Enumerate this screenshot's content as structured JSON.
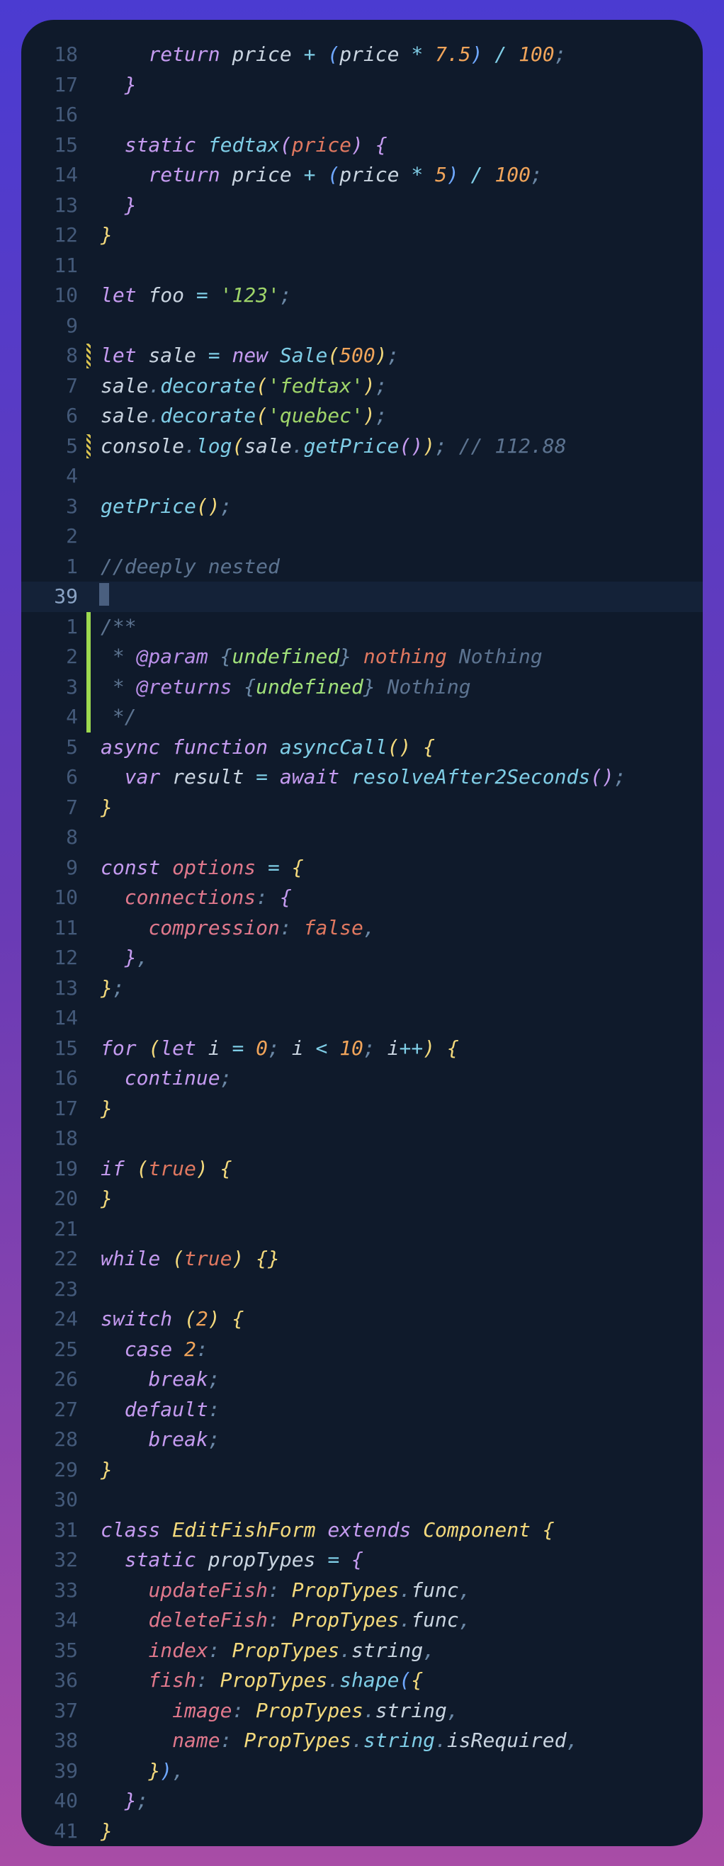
{
  "editor": {
    "theme": "dark",
    "lines": [
      {
        "ln": "18",
        "mark": null,
        "current": false,
        "html": "    <span class='t-kw'>return</span><span class='t-default'> price </span><span class='t-op'>+</span><span class='t-default'> </span><span class='t-brace-b'>(</span><span class='t-default'>price </span><span class='t-op'>*</span><span class='t-default'> </span><span class='t-num'>7.5</span><span class='t-brace-b'>)</span><span class='t-default'> </span><span class='t-op'>/</span><span class='t-default'> </span><span class='t-num'>100</span><span class='t-punc'>;</span>"
      },
      {
        "ln": "17",
        "mark": null,
        "current": false,
        "html": "  <span class='t-brace-p'>}</span>"
      },
      {
        "ln": "16",
        "mark": null,
        "current": false,
        "html": ""
      },
      {
        "ln": "15",
        "mark": null,
        "current": false,
        "html": "  <span class='t-kw'>static</span><span class='t-default'> </span><span class='t-fn t-fnst'>fedtax</span><span class='t-brace-p'>(</span><span class='t-param'>price</span><span class='t-brace-p'>)</span><span class='t-default'> </span><span class='t-brace-p'>{</span>"
      },
      {
        "ln": "14",
        "mark": null,
        "current": false,
        "html": "    <span class='t-kw'>return</span><span class='t-default'> price </span><span class='t-op'>+</span><span class='t-default'> </span><span class='t-brace-b'>(</span><span class='t-default'>price </span><span class='t-op'>*</span><span class='t-default'> </span><span class='t-num'>5</span><span class='t-brace-b'>)</span><span class='t-default'> </span><span class='t-op'>/</span><span class='t-default'> </span><span class='t-num'>100</span><span class='t-punc'>;</span>"
      },
      {
        "ln": "13",
        "mark": null,
        "current": false,
        "html": "  <span class='t-brace-p'>}</span>"
      },
      {
        "ln": "12",
        "mark": null,
        "current": false,
        "html": "<span class='t-brace-y'>}</span>"
      },
      {
        "ln": "11",
        "mark": null,
        "current": false,
        "html": ""
      },
      {
        "ln": "10",
        "mark": null,
        "current": false,
        "html": "<span class='t-kw'>let</span><span class='t-default'> foo </span><span class='t-op'>=</span><span class='t-default'> </span><span class='t-str'>'123'</span><span class='t-punc'>;</span>"
      },
      {
        "ln": "9",
        "mark": null,
        "current": false,
        "html": ""
      },
      {
        "ln": "8",
        "mark": "yellow",
        "current": false,
        "html": "<span class='t-kw'>let</span><span class='t-default'> sale </span><span class='t-op'>=</span><span class='t-default'> </span><span class='t-kw'>new</span><span class='t-default'> </span><span class='t-fn t-fnst'>Sale</span><span class='t-brace-y'>(</span><span class='t-num'>500</span><span class='t-brace-y'>)</span><span class='t-punc'>;</span>"
      },
      {
        "ln": "7",
        "mark": null,
        "current": false,
        "html": "<span class='t-default'>sale</span><span class='t-punc'>.</span><span class='t-fn t-fnst'>decorate</span><span class='t-brace-y'>(</span><span class='t-str'>'fedtax'</span><span class='t-brace-y'>)</span><span class='t-punc'>;</span>"
      },
      {
        "ln": "6",
        "mark": null,
        "current": false,
        "html": "<span class='t-default'>sale</span><span class='t-punc'>.</span><span class='t-fn t-fnst'>decorate</span><span class='t-brace-y'>(</span><span class='t-str'>'quebec'</span><span class='t-brace-y'>)</span><span class='t-punc'>;</span>"
      },
      {
        "ln": "5",
        "mark": "yellow",
        "current": false,
        "html": "<span class='t-default'>console</span><span class='t-punc'>.</span><span class='t-fn t-fnst'>log</span><span class='t-brace-y'>(</span><span class='t-default'>sale</span><span class='t-punc'>.</span><span class='t-fn t-fnst'>getPrice</span><span class='t-brace-p'>(</span><span class='t-brace-p'>)</span><span class='t-brace-y'>)</span><span class='t-punc'>;</span><span class='t-cmt'> // 112.88</span>"
      },
      {
        "ln": "4",
        "mark": null,
        "current": false,
        "html": ""
      },
      {
        "ln": "3",
        "mark": null,
        "current": false,
        "html": "<span class='t-fn t-fnst'>getPrice</span><span class='t-brace-y'>(</span><span class='t-brace-y'>)</span><span class='t-punc'>;</span>"
      },
      {
        "ln": "2",
        "mark": null,
        "current": false,
        "html": ""
      },
      {
        "ln": "1",
        "mark": null,
        "current": false,
        "html": "<span class='t-cmt'>//deeply nested</span>"
      },
      {
        "ln": "39",
        "mark": null,
        "current": true,
        "html": "<span class='cursor-block'></span>"
      },
      {
        "ln": "1",
        "mark": "green",
        "current": false,
        "html": "<span class='t-cmt'>/**</span>"
      },
      {
        "ln": "2",
        "mark": "green",
        "current": false,
        "html": "<span class='t-cmt'> * </span><span class='t-doc-kw'>@param</span><span class='t-cmt'> </span><span class='t-punc'>{</span><span class='t-doc-ty'>undefined</span><span class='t-punc'>}</span><span class='t-cmt'> </span><span class='t-param'>nothing</span><span class='t-cmt'> Nothing</span>"
      },
      {
        "ln": "3",
        "mark": "green",
        "current": false,
        "html": "<span class='t-cmt'> * </span><span class='t-doc-kw'>@returns</span><span class='t-cmt'> </span><span class='t-punc'>{</span><span class='t-doc-ty'>undefined</span><span class='t-punc'>}</span><span class='t-cmt'> Nothing</span>"
      },
      {
        "ln": "4",
        "mark": "green",
        "current": false,
        "html": "<span class='t-cmt'> */</span>"
      },
      {
        "ln": "5",
        "mark": null,
        "current": false,
        "html": "<span class='t-kw'>async</span><span class='t-default'> </span><span class='t-kw'>function</span><span class='t-default'> </span><span class='t-fn t-fnst'>asyncCall</span><span class='t-brace-y'>(</span><span class='t-brace-y'>)</span><span class='t-default'> </span><span class='t-brace-y'>{</span>"
      },
      {
        "ln": "6",
        "mark": null,
        "current": false,
        "html": "  <span class='t-kw'>var</span><span class='t-default'> result </span><span class='t-op'>=</span><span class='t-default'> </span><span class='t-kw'>await</span><span class='t-default'> </span><span class='t-fn t-fnst'>resolveAfter2Seconds</span><span class='t-brace-p'>(</span><span class='t-brace-p'>)</span><span class='t-punc'>;</span>"
      },
      {
        "ln": "7",
        "mark": null,
        "current": false,
        "html": "<span class='t-brace-y'>}</span>"
      },
      {
        "ln": "8",
        "mark": null,
        "current": false,
        "html": ""
      },
      {
        "ln": "9",
        "mark": null,
        "current": false,
        "html": "<span class='t-kw'>const</span><span class='t-default'> </span><span class='t-prop'>options</span><span class='t-default'> </span><span class='t-op'>=</span><span class='t-default'> </span><span class='t-brace-y'>{</span>"
      },
      {
        "ln": "10",
        "mark": null,
        "current": false,
        "html": "  <span class='t-prop'>connections</span><span class='t-punc'>:</span><span class='t-default'> </span><span class='t-brace-p'>{</span>"
      },
      {
        "ln": "11",
        "mark": null,
        "current": false,
        "html": "    <span class='t-prop'>compression</span><span class='t-punc'>:</span><span class='t-default'> </span><span class='t-bool'>false</span><span class='t-punc'>,</span>"
      },
      {
        "ln": "12",
        "mark": null,
        "current": false,
        "html": "  <span class='t-brace-p'>}</span><span class='t-punc'>,</span>"
      },
      {
        "ln": "13",
        "mark": null,
        "current": false,
        "html": "<span class='t-brace-y'>}</span><span class='t-punc'>;</span>"
      },
      {
        "ln": "14",
        "mark": null,
        "current": false,
        "html": ""
      },
      {
        "ln": "15",
        "mark": null,
        "current": false,
        "html": "<span class='t-kw'>for</span><span class='t-default'> </span><span class='t-brace-y'>(</span><span class='t-kw'>let</span><span class='t-default'> i </span><span class='t-op'>=</span><span class='t-default'> </span><span class='t-num'>0</span><span class='t-punc'>;</span><span class='t-default'> i </span><span class='t-op'>&lt;</span><span class='t-default'> </span><span class='t-num'>10</span><span class='t-punc'>;</span><span class='t-default'> i</span><span class='t-op'>++</span><span class='t-brace-y'>)</span><span class='t-default'> </span><span class='t-brace-y'>{</span>"
      },
      {
        "ln": "16",
        "mark": null,
        "current": false,
        "html": "  <span class='t-kw'>continue</span><span class='t-punc'>;</span>"
      },
      {
        "ln": "17",
        "mark": null,
        "current": false,
        "html": "<span class='t-brace-y'>}</span>"
      },
      {
        "ln": "18",
        "mark": null,
        "current": false,
        "html": ""
      },
      {
        "ln": "19",
        "mark": null,
        "current": false,
        "html": "<span class='t-kw'>if</span><span class='t-default'> </span><span class='t-brace-y'>(</span><span class='t-bool'>true</span><span class='t-brace-y'>)</span><span class='t-default'> </span><span class='t-brace-y'>{</span>"
      },
      {
        "ln": "20",
        "mark": null,
        "current": false,
        "html": "<span class='t-brace-y'>}</span>"
      },
      {
        "ln": "21",
        "mark": null,
        "current": false,
        "html": ""
      },
      {
        "ln": "22",
        "mark": null,
        "current": false,
        "html": "<span class='t-kw'>while</span><span class='t-default'> </span><span class='t-brace-y'>(</span><span class='t-bool'>true</span><span class='t-brace-y'>)</span><span class='t-default'> </span><span class='t-brace-y'>{</span><span class='t-brace-y'>}</span>"
      },
      {
        "ln": "23",
        "mark": null,
        "current": false,
        "html": ""
      },
      {
        "ln": "24",
        "mark": null,
        "current": false,
        "html": "<span class='t-kw'>switch</span><span class='t-default'> </span><span class='t-brace-y'>(</span><span class='t-num'>2</span><span class='t-brace-y'>)</span><span class='t-default'> </span><span class='t-brace-y'>{</span>"
      },
      {
        "ln": "25",
        "mark": null,
        "current": false,
        "html": "  <span class='t-kw'>case</span><span class='t-default'> </span><span class='t-num'>2</span><span class='t-punc'>:</span>"
      },
      {
        "ln": "26",
        "mark": null,
        "current": false,
        "html": "    <span class='t-kw'>break</span><span class='t-punc'>;</span>"
      },
      {
        "ln": "27",
        "mark": null,
        "current": false,
        "html": "  <span class='t-kw'>default</span><span class='t-punc'>:</span>"
      },
      {
        "ln": "28",
        "mark": null,
        "current": false,
        "html": "    <span class='t-kw'>break</span><span class='t-punc'>;</span>"
      },
      {
        "ln": "29",
        "mark": null,
        "current": false,
        "html": "<span class='t-brace-y'>}</span>"
      },
      {
        "ln": "30",
        "mark": null,
        "current": false,
        "html": ""
      },
      {
        "ln": "31",
        "mark": null,
        "current": false,
        "html": "<span class='t-kw'>class</span><span class='t-default'> </span><span class='t-cls'>EditFishForm</span><span class='t-default'> </span><span class='t-kw'>extends</span><span class='t-default'> </span><span class='t-cls'>Component</span><span class='t-default'> </span><span class='t-brace-y'>{</span>"
      },
      {
        "ln": "32",
        "mark": null,
        "current": false,
        "html": "  <span class='t-kw'>static</span><span class='t-default'> propTypes </span><span class='t-op'>=</span><span class='t-default'> </span><span class='t-brace-p'>{</span>"
      },
      {
        "ln": "33",
        "mark": null,
        "current": false,
        "html": "    <span class='t-prop'>updateFish</span><span class='t-punc'>:</span><span class='t-default'> </span><span class='t-cls'>PropTypes</span><span class='t-punc'>.</span><span class='t-default'>func</span><span class='t-punc'>,</span>"
      },
      {
        "ln": "34",
        "mark": null,
        "current": false,
        "html": "    <span class='t-prop'>deleteFish</span><span class='t-punc'>:</span><span class='t-default'> </span><span class='t-cls'>PropTypes</span><span class='t-punc'>.</span><span class='t-default'>func</span><span class='t-punc'>,</span>"
      },
      {
        "ln": "35",
        "mark": null,
        "current": false,
        "html": "    <span class='t-prop'>index</span><span class='t-punc'>:</span><span class='t-default'> </span><span class='t-cls'>PropTypes</span><span class='t-punc'>.</span><span class='t-default'>string</span><span class='t-punc'>,</span>"
      },
      {
        "ln": "36",
        "mark": null,
        "current": false,
        "html": "    <span class='t-prop'>fish</span><span class='t-punc'>:</span><span class='t-default'> </span><span class='t-cls'>PropTypes</span><span class='t-punc'>.</span><span class='t-fn t-fnst'>shape</span><span class='t-brace-b'>(</span><span class='t-brace-y'>{</span>"
      },
      {
        "ln": "37",
        "mark": null,
        "current": false,
        "html": "      <span class='t-prop'>image</span><span class='t-punc'>:</span><span class='t-default'> </span><span class='t-cls'>PropTypes</span><span class='t-punc'>.</span><span class='t-default'>string</span><span class='t-punc'>,</span>"
      },
      {
        "ln": "38",
        "mark": null,
        "current": false,
        "html": "      <span class='t-prop'>name</span><span class='t-punc'>:</span><span class='t-default'> </span><span class='t-cls'>PropTypes</span><span class='t-punc'>.</span><span class='t-fn t-fnst'>string</span><span class='t-punc'>.</span><span class='t-default'>isRequired</span><span class='t-punc'>,</span>"
      },
      {
        "ln": "39",
        "mark": null,
        "current": false,
        "html": "    <span class='t-brace-y'>}</span><span class='t-brace-b'>)</span><span class='t-punc'>,</span>"
      },
      {
        "ln": "40",
        "mark": null,
        "current": false,
        "html": "  <span class='t-brace-p'>}</span><span class='t-punc'>;</span>"
      },
      {
        "ln": "41",
        "mark": null,
        "current": false,
        "html": "<span class='t-brace-y'>}</span>"
      }
    ]
  }
}
